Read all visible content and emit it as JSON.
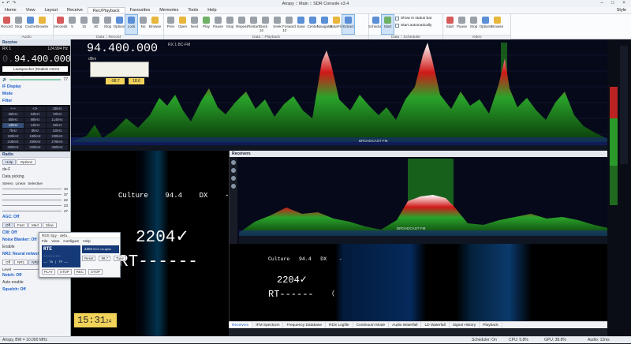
{
  "title": "Airspy :: Main :: SDR Console v3.4",
  "menu": {
    "items": [
      "Home",
      "View",
      "Layout",
      "Receive",
      "Rec/Playback",
      "Favourites",
      "Memories",
      "Tools",
      "Help"
    ],
    "selected": "Rec/Playback",
    "style_label": "Style"
  },
  "ribbon": {
    "audio": {
      "label": "Audio",
      "buttons": [
        "Record",
        "Stop",
        "Cache",
        "Browse"
      ]
    },
    "record": {
      "label": "Data :: Record",
      "buttons": [
        "Seconds",
        "5",
        "15",
        "30",
        "Stop",
        "Options",
        "Lock",
        "No",
        "Browse"
      ],
      "sub": [
        "1 min",
        "2 min",
        "3 min",
        "5 min",
        "ADC",
        "Bandwidth"
      ]
    },
    "playback": {
      "label": "Data :: Playback",
      "buttons": [
        "Prev",
        "Open",
        "Next",
        "Play",
        "Pause",
        "Stop",
        "Repeat",
        "Restart",
        "Back 10",
        "Seek",
        "Forward 10",
        "Save",
        "Center",
        "Navigator",
        "DataFile",
        "Extract"
      ]
    },
    "scheduler": {
      "label": "Data :: Scheduler",
      "buttons": [
        "Schedule",
        "Start"
      ],
      "checks": [
        "Show in status bar",
        "Start automatically"
      ]
    },
    "video": {
      "label": "Video",
      "buttons": [
        "Start",
        "Pause",
        "Stop",
        "Options",
        "Browse"
      ]
    }
  },
  "left": {
    "receive_header": "Receive",
    "rx": {
      "label": "RX 1",
      "bandwidth": "124.994 Hz",
      "freq_prefix": "0.",
      "freq": "94.400.000",
      "device": "Lautsprecher (Realtek ASIO1 Audio)"
    },
    "volume": "77",
    "sections": [
      "IF Display",
      "Mode",
      "Filter"
    ],
    "filters": [
      "+++",
      "+2+",
      "43kHz",
      "56kHz",
      "64kHz",
      "72kHz",
      "80kHz",
      "88kHz",
      "114kHz",
      "12kHz",
      "14kHz",
      "16kHz",
      "7kHz",
      "8kHz",
      "12kHz",
      "150kHz",
      "180kHz",
      "200kHz",
      "216kHz",
      "250kHz",
      "276kHz",
      "300kHz",
      "320kHz",
      "350kHz"
    ],
    "radio_header": "Radio",
    "radio_tabs": [
      "Help",
      "Options"
    ],
    "radio_rows": [
      "de-F",
      "Data picking",
      "Stereo"
    ],
    "stereo_opts": [
      "Linear",
      "Selective"
    ],
    "slider_vals": [
      "10",
      "37",
      "22",
      "23",
      "47"
    ],
    "agc": "AGC: Off",
    "agc_tabs": [
      "Off",
      "Fast",
      "Med",
      "Slow"
    ],
    "cw": "CW: Off",
    "nb": "Noise Blanker: Off",
    "nb_enable": "Enable",
    "nr2": "NR2: Neural network",
    "nr2_tabs": [
      "Off",
      "NR1",
      "NR2"
    ],
    "level": "Level",
    "notch": "Notch: Off",
    "notch_auto": "Auto enable",
    "squelch": "Squelch: Off"
  },
  "spectrum": {
    "freq": "94.400.000",
    "s_meter_a": "-98.7",
    "s_meter_b": "18.6",
    "mode_tag": "RX 1  BC-FM",
    "unit": "dBm",
    "broadcast": "BROADCAST FM"
  },
  "rds_main": {
    "line1": "Culture    94.4    DX    -",
    "pi": "2204✓",
    "rt": "RT------"
  },
  "clock": {
    "time": "15:31",
    "sec": "24"
  },
  "rdsspy": {
    "title": "RDS Spy - defa...",
    "menu": [
      "File",
      "View",
      "Configure",
      "Help"
    ],
    "ps": "RTE",
    "rt": "-------",
    "bot": "—— TA | TP  ——",
    "pi_label": "2204",
    "pi_extra": "ECC  no-sync",
    "btns": [
      "Reset",
      "99.7",
      "Tune"
    ],
    "btns2": [
      "PLAY",
      "STOP",
      "REC",
      "STOP"
    ]
  },
  "receivers": {
    "header": "Receivers",
    "broadcast": "BROADCAST FM",
    "rds1": "Culture   94.4   DX    -",
    "pi": "2204✓",
    "rt": "RT------",
    "glyph": "("
  },
  "bottom_tabs": [
    "Receivers",
    "IFM Spectrum",
    "Frequency Database",
    "RDS Logfile",
    "Continuum Mode",
    "Audio Waterfall",
    "LD Waterfall",
    "Signal History",
    "Playback"
  ],
  "status": {
    "left": "Airspy, BW = 10.000 MHz",
    "scheduler": "Scheduler: On",
    "cpu": "CPU: 5.8%",
    "gpu": "GPU: 38.8%",
    "audio": "Audio: 12ms"
  }
}
